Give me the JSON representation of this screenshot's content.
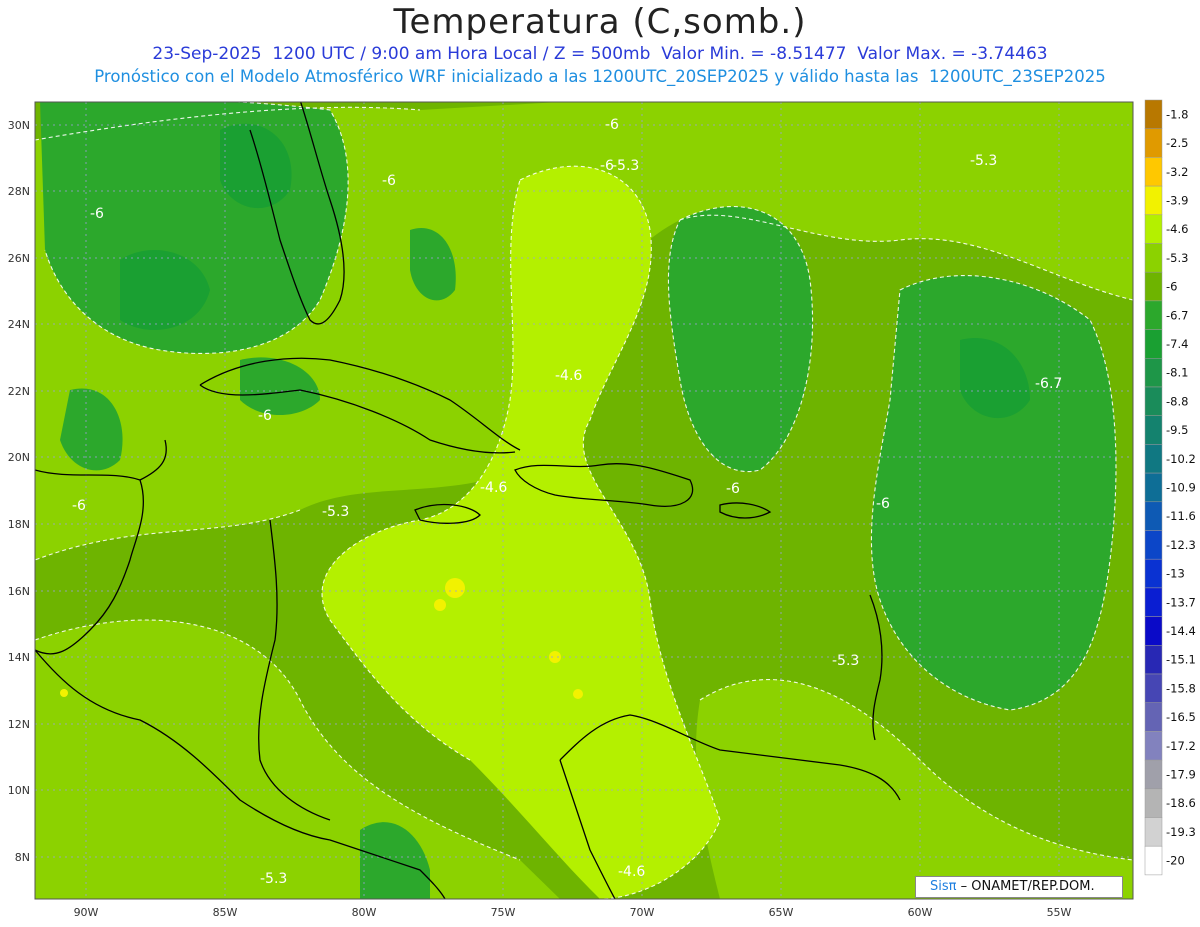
{
  "header": {
    "title": "Temperatura (C,somb.)",
    "line1": "23-Sep-2025  1200 UTC / 9:00 am Hora Local / Z = 500mb  Valor Min. = -8.51477  Valor Max. = -3.74463",
    "line2": "Pronóstico con el Modelo Atmosférico WRF inicializado a las 1200UTC_20SEP2025 y válido hasta las  1200UTC_23SEP2025"
  },
  "map": {
    "lat_labels": [
      "30N",
      "28N",
      "26N",
      "24N",
      "22N",
      "20N",
      "18N",
      "16N",
      "14N",
      "12N",
      "10N",
      "8N"
    ],
    "lon_labels": [
      "90W",
      "85W",
      "80W",
      "75W",
      "70W",
      "65W",
      "60W",
      "55W"
    ],
    "contour_labels": [
      "-6",
      "-5.3",
      "-6",
      "-6",
      "-6",
      "-5.3",
      "-4.6",
      "-6.7",
      "-6",
      "-4.6",
      "-6",
      "-6",
      "-5.3",
      "-6",
      "-5.3",
      "-5.3",
      "-4.6"
    ]
  },
  "colorbar": {
    "labels": [
      "-1.8",
      "-2.5",
      "-3.2",
      "-3.9",
      "-4.6",
      "-5.3",
      "-6",
      "-6.7",
      "-7.4",
      "-8.1",
      "-8.8",
      "-9.5",
      "-10.2",
      "-10.9",
      "-11.6",
      "-12.3",
      "-13",
      "-13.7",
      "-14.4",
      "-15.1",
      "-15.8",
      "-16.5",
      "-17.2",
      "-17.9",
      "-18.6",
      "-19.3",
      "-20"
    ],
    "colors": [
      "#b87800",
      "#e09a00",
      "#ffc800",
      "#f2f200",
      "#b4f000",
      "#8cd200",
      "#6eb400",
      "#2ca82c",
      "#1aa032",
      "#1e9648",
      "#1a8c5a",
      "#14826e",
      "#107882",
      "#0e6e96",
      "#0e5ab4",
      "#0c46c8",
      "#0a32d2",
      "#0a1ed2",
      "#0a0ac8",
      "#2828b4",
      "#4646b4",
      "#6464b4",
      "#8282be",
      "#a0a0aa",
      "#b4b4b4",
      "#d2d2d2",
      "#ffffff"
    ]
  },
  "credit": {
    "brand": "Sisπ",
    "text": " – ONAMET/REP.DOM."
  }
}
